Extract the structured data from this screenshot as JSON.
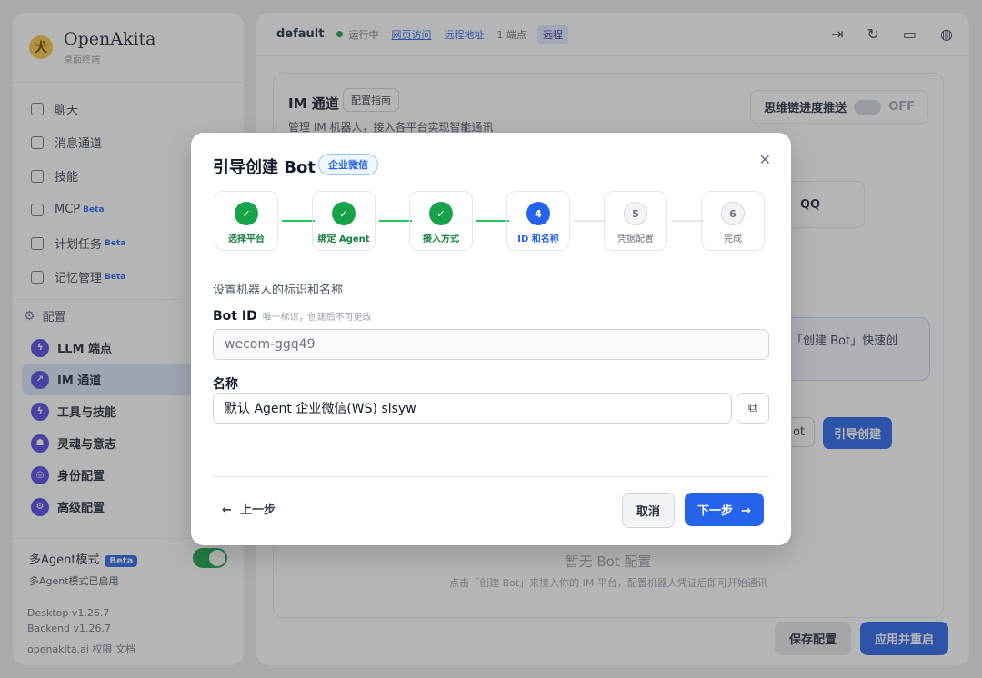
{
  "app": {
    "title": "OpenAkita",
    "subtitle": "桌面终端"
  },
  "sidebar": {
    "items": [
      {
        "label": "聊天"
      },
      {
        "label": "消息通道"
      },
      {
        "label": "技能"
      },
      {
        "label": "MCP",
        "badge": "Beta"
      },
      {
        "label": "计划任务",
        "badge": "Beta"
      },
      {
        "label": "记忆管理",
        "badge": "Beta"
      }
    ],
    "config_label": "配置",
    "config_items": [
      {
        "label": "LLM 端点"
      },
      {
        "label": "IM 通道"
      },
      {
        "label": "工具与技能"
      },
      {
        "label": "灵魂与意志"
      },
      {
        "label": "身份配置"
      },
      {
        "label": "高级配置"
      }
    ],
    "multi_agent": {
      "label": "多Agent模式",
      "badge": "Beta",
      "status": "多Agent模式已启用"
    },
    "version_desktop": "Desktop v1.26.7",
    "version_backend": "Backend v1.26.7",
    "links": "openakita.ai  权限  文档"
  },
  "topbar": {
    "workspace": "default",
    "status": "运行中",
    "web": "网页访问",
    "remote": "远程地址",
    "count": "1 端点",
    "tag": "远程"
  },
  "page": {
    "title": "IM 通道",
    "guide": "配置指南",
    "subtitle": "管理 IM 机器人，接入各平台实现智能通讯",
    "think_label": "思维链进度推送",
    "think_state": "OFF",
    "qq": "QQ",
    "hint": "「创建 Bot」快速创",
    "ot": "ot",
    "guide_create": "引导创建",
    "empty_title": "暂无 Bot 配置",
    "empty_sub": "点击「创建 Bot」来接入你的 IM 平台，配置机器人凭证后即可开始通讯",
    "save": "保存配置",
    "apply": "应用并重启"
  },
  "modal": {
    "title": "引导创建 Bot",
    "platform": "企业微信",
    "steps": [
      {
        "n": "✓",
        "label": "选择平台"
      },
      {
        "n": "✓",
        "label": "绑定 Agent"
      },
      {
        "n": "✓",
        "label": "接入方式"
      },
      {
        "n": "4",
        "label": "ID 和名称"
      },
      {
        "n": "5",
        "label": "凭据配置"
      },
      {
        "n": "6",
        "label": "完成"
      }
    ],
    "desc": "设置机器人的标识和名称",
    "bot_id_label": "Bot ID",
    "bot_id_hint": "唯一标识，创建后不可更改",
    "bot_id_value": "wecom-ggq49",
    "name_label": "名称",
    "name_value": "默认 Agent 企业微信(WS) slsyw",
    "back": "上一步",
    "cancel": "取消",
    "next": "下一步"
  }
}
